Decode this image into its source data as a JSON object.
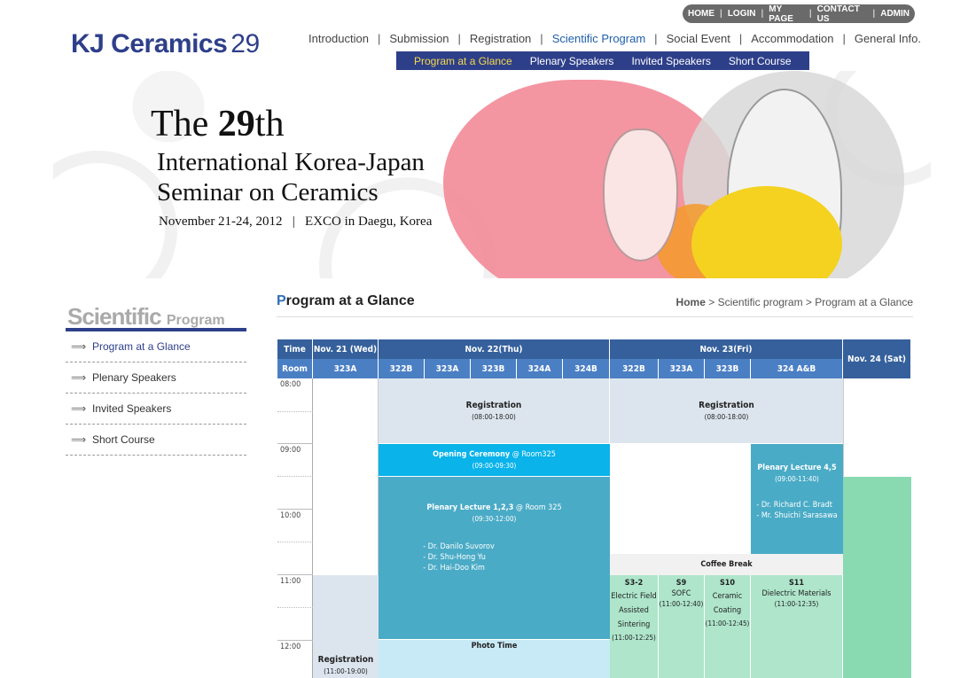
{
  "header": {
    "logo_text": "KJ Ceramics",
    "logo_num": "29",
    "util_links": [
      "HOME",
      "LOGIN",
      "MY PAGE",
      "CONTACT US",
      "ADMIN"
    ],
    "nav": [
      "Introduction",
      "Submission",
      "Registration",
      "Scientific Program",
      "Social Event",
      "Accommodation",
      "General Info."
    ],
    "subnav": [
      "Program at a Glance",
      "Plenary Speakers",
      "Invited Speakers",
      "Short Course"
    ]
  },
  "banner": {
    "line1_a": "The ",
    "line1_b": "29",
    "line1_c": "th",
    "line2": "International Korea-Japan",
    "line3": "Seminar on Ceramics",
    "line4": "November 21-24, 2012   |   EXCO in Daegu, Korea"
  },
  "sidebar": {
    "title_big": "Scientific",
    "title_small": "Program",
    "items": [
      "Program at a Glance",
      "Plenary Speakers",
      "Invited Speakers",
      "Short Course"
    ]
  },
  "content": {
    "title_first": "P",
    "title_rest": "rogram at a Glance",
    "breadcrumb_home": "Home",
    "breadcrumb_rest": " > Scientific program > Program at a Glance"
  },
  "schedule": {
    "time_label": "Time",
    "room_label": "Room",
    "days": [
      "Nov. 21 (Wed)",
      "Nov. 22(Thu)",
      "Nov. 23(Fri)",
      "Nov. 24 (Sat)"
    ],
    "rooms": [
      "323A",
      "322B",
      "323A",
      "323B",
      "324A",
      "324B",
      "322B",
      "323A",
      "323B",
      "324 A&B"
    ],
    "times": [
      "08:00",
      "09:00",
      "10:00",
      "11:00",
      "12:00"
    ],
    "reg_thu": {
      "title": "Registration",
      "time": "(08:00-18:00)"
    },
    "reg_fri": {
      "title": "Registration",
      "time": "(08:00-18:00)"
    },
    "reg_wed": {
      "title": "Registration",
      "time": "(11:00-19:00)"
    },
    "opening": {
      "title": "Opening Ceremony",
      "where": " @ Room325",
      "time": "(09:00-09:30)"
    },
    "plenary123": {
      "title": "Plenary Lecture 1,2,3",
      "where": " @ Room 325",
      "time": "(09:30-12:00)",
      "speakers": [
        "- Dr. Danilo Suvorov",
        "- Dr. Shu-Hong Yu",
        "- Dr. Hai-Doo Kim"
      ]
    },
    "plenary45": {
      "title": "Plenary Lecture 4,5",
      "time": "(09:00-11:40)",
      "speakers": [
        "- Dr. Richard C. Bradt",
        "- Mr. Shuichi Sarasawa"
      ]
    },
    "coffee": "Coffee Break",
    "photo": "Photo Time",
    "sessions": [
      {
        "code": "S3-2",
        "name": "Electric Field Assisted Sintering",
        "time": "(11:00-12:25)"
      },
      {
        "code": "S9",
        "name": "SOFC",
        "time": "(11:00-12:40)"
      },
      {
        "code": "S10",
        "name": "Ceramic Coating",
        "time": "(11:00-12:45)"
      },
      {
        "code": "S11",
        "name": "Dielectric Materials",
        "time": "(11:00-12:35)"
      }
    ]
  }
}
